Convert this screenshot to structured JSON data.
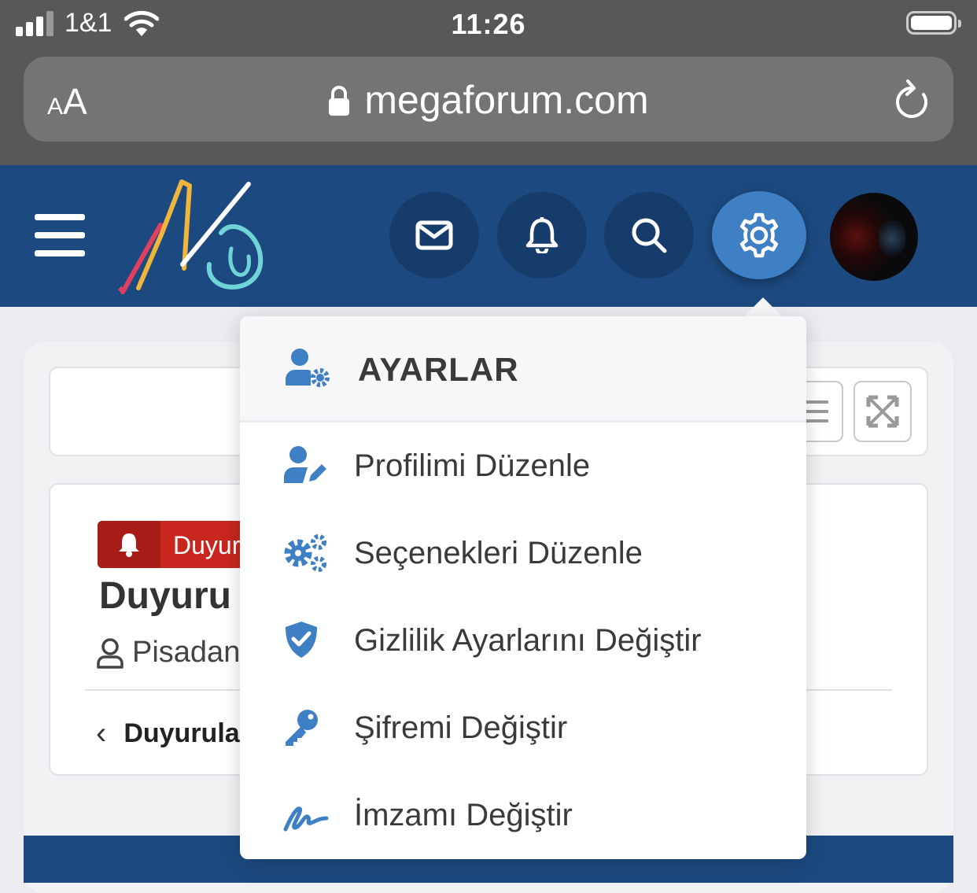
{
  "status_bar": {
    "carrier": "1&1",
    "time": "11:26"
  },
  "browser": {
    "text_size_small": "A",
    "text_size_large": "A",
    "url": "megaforum.com"
  },
  "header": {
    "buttons": [
      "messages-icon",
      "notifications-icon",
      "search-icon",
      "settings-icon"
    ],
    "active_button": "settings-icon",
    "colors": {
      "header_bg": "#1c4a80",
      "accent": "#3f7fc4"
    }
  },
  "thread": {
    "badge_label": "Duyur",
    "title": "Duyuru",
    "author": "Pisadan",
    "back_label": "Duyurula"
  },
  "settings_menu": {
    "title": "AYARLAR",
    "items": [
      {
        "label": "Profilimi Düzenle",
        "icon": "user-edit-icon"
      },
      {
        "label": "Seçenekleri Düzenle",
        "icon": "cogs-icon"
      },
      {
        "label": "Gizlilik Ayarlarını Değiştir",
        "icon": "shield-check-icon"
      },
      {
        "label": "Şifremi Değiştir",
        "icon": "key-icon"
      },
      {
        "label": "İmzamı Değiştir",
        "icon": "signature-icon"
      }
    ]
  }
}
